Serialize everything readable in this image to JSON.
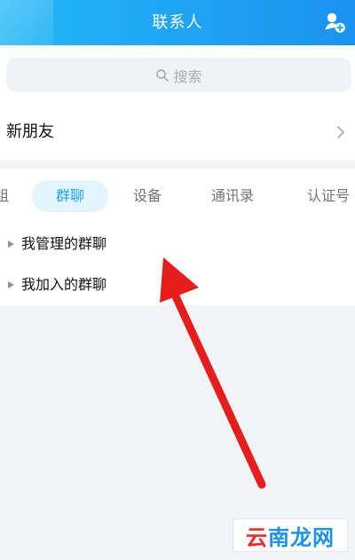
{
  "header": {
    "title": "联系人"
  },
  "search": {
    "placeholder": "搜索"
  },
  "new_friends": {
    "label": "新朋友"
  },
  "tabs": [
    {
      "label": "组"
    },
    {
      "label": "群聊"
    },
    {
      "label": "设备"
    },
    {
      "label": "通讯录"
    },
    {
      "label": "认证号"
    }
  ],
  "groups": [
    {
      "label": "我管理的群聊"
    },
    {
      "label": "我加入的群聊"
    }
  ],
  "watermark": {
    "part1": "云",
    "part2": "南",
    "part3": "龙网"
  },
  "colors": {
    "header": "#1ea3f3",
    "accent": "#1aa3ef",
    "active_tab_bg": "#e5f5fd",
    "annotation_red": "#e61d1d"
  }
}
